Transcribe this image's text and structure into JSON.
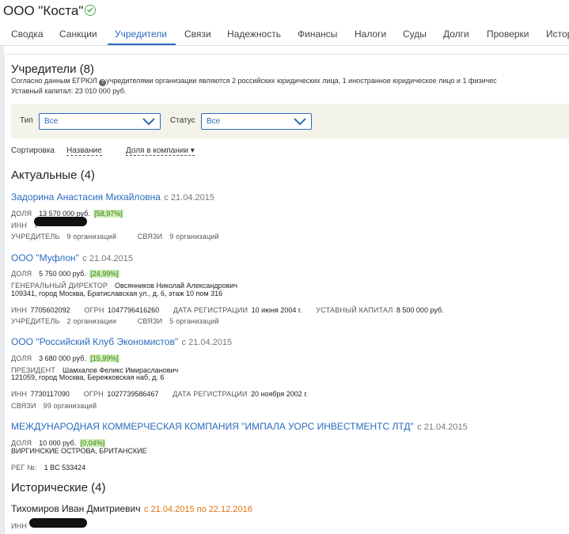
{
  "header": {
    "title": "ООО \"Коста\"",
    "verified_icon": "check-circle-icon"
  },
  "tabs": [
    "Сводка",
    "Санкции",
    "Учредители",
    "Связи",
    "Надежность",
    "Финансы",
    "Налоги",
    "Суды",
    "Долги",
    "Проверки",
    "Истор"
  ],
  "active_tab": "Учредители",
  "section": {
    "title": "Учредители (8)",
    "desc_before_icon": "Согласно данным ЕГРЮЛ",
    "desc_after_icon": "учредителями организации являются 2 российских юридических лица, 1 иностранное юридическое лицо и 1 физичес",
    "capital": "Уставный капитал: 23 010 000 руб."
  },
  "filters": {
    "type_label": "Тип",
    "type_value": "Все",
    "status_label": "Статус",
    "status_value": "Все"
  },
  "sort": {
    "label": "Сортировка",
    "by_name": "Название",
    "by_share": "Доля в компании",
    "arrow": "▾"
  },
  "actual": {
    "title": "Актуальные (4)",
    "items": [
      {
        "name": "Задорина Анастасия Михайловна",
        "since": "с 21.04.2015",
        "share_label": "ДОЛЯ",
        "share": "13 570 000 руб.",
        "pct": "[58,97%]",
        "inn_label": "ИНН",
        "inn_prefix": "7",
        "founder_label": "УЧРЕДИТЕЛЬ",
        "founder_link": "9 организаций",
        "links_label": "СВЯЗИ",
        "links_link": "9 организаций"
      },
      {
        "name": "ООО \"Муфлон\"",
        "since": "с 21.04.2015",
        "share_label": "ДОЛЯ",
        "share": "5 750 000 руб.",
        "pct": "[24,99%]",
        "role_label": "ГЕНЕРАЛЬНЫЙ ДИРЕКТОР",
        "role_value": "Овсянников Николай Александрович",
        "address": "109341, город Москва, Братиславская ул., д. 6, этаж 10 пом 316",
        "inn_label": "ИНН",
        "inn": "7705602092",
        "ogrn_label": "ОГРН",
        "ogrn": "1047796416260",
        "reg_label": "ДАТА РЕГИСТРАЦИИ",
        "reg": "10 июня 2004 г.",
        "cap_label": "УСТАВНЫЙ КАПИТАЛ",
        "cap": "8 500 000 руб.",
        "founder_label": "УЧРЕДИТЕЛЬ",
        "founder_link": "2 организации",
        "links_label": "СВЯЗИ",
        "links_link": "5 организаций"
      },
      {
        "name": "ООО \"Российский Клуб Экономистов\"",
        "since": "с 21.04.2015",
        "share_label": "ДОЛЯ",
        "share": "3 680 000 руб.",
        "pct": "[15,99%]",
        "role_label": "ПРЕЗИДЕНТ",
        "role_value": "Шамхалов Феликс Имирасланович",
        "address": "121059, город Москва, Бережковская наб, д. 6",
        "inn_label": "ИНН",
        "inn": "7730117090",
        "ogrn_label": "ОГРН",
        "ogrn": "1027739586467",
        "reg_label": "ДАТА РЕГИСТРАЦИИ",
        "reg": "20 ноября 2002 г.",
        "links_label": "СВЯЗИ",
        "links_link": "99 организаций"
      },
      {
        "name": "МЕЖДУНАРОДНАЯ КОММЕРЧЕСКАЯ КОМПАНИЯ \"ИМПАЛА УОРС ИНВЕСТМЕНТС ЛТД\"",
        "since": "с 21.04.2015",
        "share_label": "ДОЛЯ",
        "share": "10 000 руб.",
        "pct": "[0,04%]",
        "country": "ВИРГИНСКИЕ ОСТРОВА, БРИТАНСКИЕ",
        "regno_label": "РЕГ №:",
        "regno": "1 BC 533424"
      }
    ]
  },
  "historical": {
    "title": "Исторические (4)",
    "items": [
      {
        "name": "Тихомиров Иван Дмитриевич",
        "period": "с 21.04.2015 по 22.12.2016",
        "inn_label": "ИНН"
      }
    ]
  }
}
